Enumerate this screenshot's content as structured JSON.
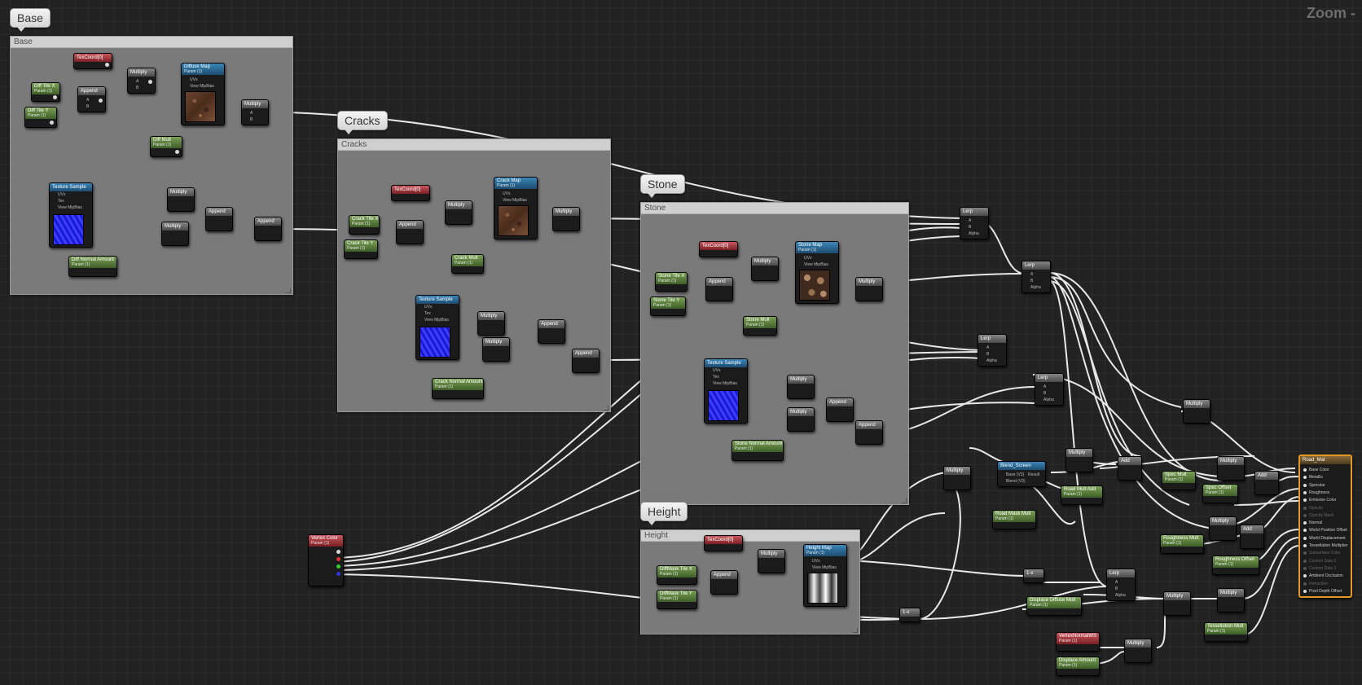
{
  "zoom_label": "Zoom -",
  "groups": [
    {
      "bubble": "Base",
      "header": "Base"
    },
    {
      "bubble": "Cracks",
      "header": "Cracks"
    },
    {
      "bubble": "Stone",
      "header": "Stone"
    },
    {
      "bubble": "Height",
      "header": "Height"
    }
  ],
  "nodes": {
    "texcoord_base": "TexCoord[0]",
    "diff_tile_x": "Diff Tile X",
    "diff_tile_y": "Diff Tile Y",
    "append_base": "Append",
    "multiply_base_1": "Multiply",
    "diffuse_map": "Diffuse Map",
    "multiply_base_2": "Multiply",
    "diff_mult": "Diff Mult",
    "texture_sample_base": "Texture Sample",
    "multiply_base_3": "Multiply",
    "multiply_base_4": "Multiply",
    "append_base_2": "Append",
    "append_base_3": "Append",
    "diff_normal_amount": "Diff Normal Amount",
    "texcoord_cracks": "TexCoord[0]",
    "crack_map": "Crack Map",
    "crack_tile_x": "Crack Tile X",
    "crack_tile_y": "Crack Tile Y",
    "append_cracks": "Append",
    "multiply_cracks_1": "Multiply",
    "multiply_cracks_2": "Multiply",
    "crack_mult": "Crack Mult",
    "texture_sample_cracks": "Texture Sample",
    "multiply_cracks_3": "Multiply",
    "multiply_cracks_4": "Multiply",
    "append_cracks_2": "Append",
    "append_cracks_3": "Append",
    "crack_normal_amount": "Crack Normal Amount",
    "texcoord_stone": "TexCoord[0]",
    "stone_map": "Stone Map",
    "stone_tile_x": "Stone Tile X",
    "stone_tile_y": "Stone Tile Y",
    "append_stone": "Append",
    "multiply_stone_1": "Multiply",
    "multiply_stone_2": "Multiply",
    "stone_mult": "Stone Mult",
    "texture_sample_stone": "Texture Sample",
    "multiply_stone_3": "Multiply",
    "multiply_stone_4": "Multiply",
    "append_stone_2": "Append",
    "append_stone_3": "Append",
    "stone_normal_amount": "Stone Normal Amount",
    "texcoord_height": "TexCoord[0]",
    "height_map": "Height Map",
    "diffmask_tile_x": "DiffMask Tile X",
    "diffmask_tile_y": "DiffMask Tile Y",
    "append_height": "Append",
    "multiply_height": "Multiply",
    "vertex_color": "Vertex Color",
    "lerp_1": "Lerp",
    "lerp_2": "Lerp",
    "lerp_3": "Lerp",
    "lerp_4": "Lerp",
    "lerp_5": "Lerp",
    "blend_screen": "Blend_Screen",
    "road_mult_add": "Road Mult Add",
    "road_mask_mult": "Road Mask Mult",
    "multiply_m1": "Multiply",
    "multiply_m2": "Multiply",
    "multiply_m3": "Multiply",
    "multiply_m4": "Multiply",
    "multiply_m5": "Multiply",
    "multiply_m6": "Multiply",
    "multiply_m7": "Multiply",
    "multiply_m8": "Multiply",
    "add_1": "Add",
    "add_2": "Add",
    "add_3": "Add",
    "spec_mult": "Spec Mult",
    "spec_offset": "Spec Offset",
    "roughness_mult": "Roughness Mult",
    "roughness_offset": "Roughness Offset",
    "displace_diffuse_mult": "Displace Diffuse Mult",
    "vertex_normal_ws": "VertexNormalWS",
    "displace_amount": "Displace Amount",
    "tessellation_mult": "Tessellation Mult",
    "one_minus_1": "1-x",
    "one_minus_2": "1-x"
  },
  "pin_labels": {
    "a": "A",
    "b": "B",
    "alpha": "Alpha",
    "uvs": "UVs",
    "tex": "Tex",
    "view_mip_bias": "View MipBias",
    "blend_result": "Result",
    "blend_base": "Base (V3)",
    "blend_blend": "Blend (V3)"
  },
  "param_subtitle": "Param (1)",
  "result_node": {
    "title": "Road_Mat",
    "inputs": [
      "Base Color",
      "Metallic",
      "Specular",
      "Roughness",
      "Emissive Color",
      "Opacity",
      "Opacity Mask",
      "Normal",
      "World Position Offset",
      "World Displacement",
      "Tessellation Multiplier",
      "Subsurface Color",
      "Custom Data 0",
      "Custom Data 1",
      "Ambient Occlusion",
      "Refraction",
      "Pixel Depth Offset"
    ],
    "inputs_enabled": [
      true,
      true,
      true,
      true,
      true,
      false,
      false,
      true,
      true,
      true,
      true,
      false,
      false,
      false,
      true,
      false,
      true
    ]
  }
}
